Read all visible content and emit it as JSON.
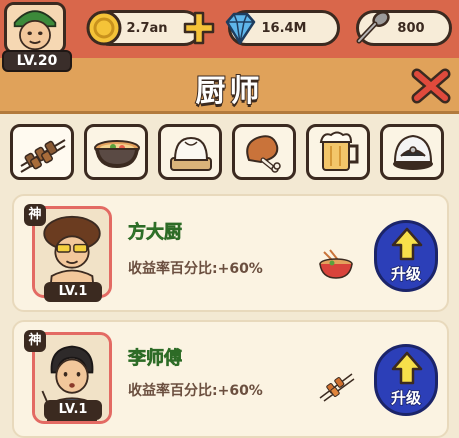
{
  "player": {
    "level": "LV.20"
  },
  "currency": {
    "coins": "2.7an",
    "gems": "16.4M",
    "spoons": "800"
  },
  "header": {
    "title": "厨师"
  },
  "tabs": [
    {
      "icon": "skewer-icon"
    },
    {
      "icon": "noodle-bowl-icon"
    },
    {
      "icon": "steamed-bun-icon"
    },
    {
      "icon": "chicken-leg-icon"
    },
    {
      "icon": "beer-mug-icon"
    },
    {
      "icon": "rice-cooker-icon"
    }
  ],
  "chefs": [
    {
      "rarity": "神",
      "level": "LV.1",
      "name": "方大厨",
      "stat": "收益率百分比:+60%",
      "dish_icon": "noodle-bowl-icon",
      "upgrade_label": "升级"
    },
    {
      "rarity": "神",
      "level": "LV.1",
      "name": "李师傅",
      "stat": "收益率百分比:+60%",
      "dish_icon": "skewer-icon",
      "upgrade_label": "升级"
    }
  ],
  "colors": {
    "topbar": "#d9674b",
    "header": "#e0a25a",
    "name_green": "#3ea43a",
    "upgrade_blue": "#2c3fb8",
    "close_red": "#e04a3c"
  }
}
